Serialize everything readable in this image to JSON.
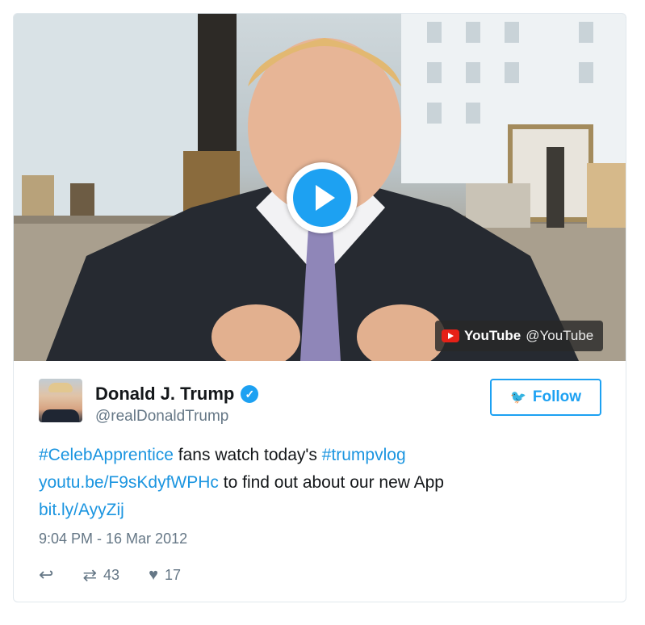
{
  "video": {
    "source_name": "YouTube",
    "source_handle": "@YouTube",
    "play_icon": "play-icon",
    "youtube_icon": "youtube-logo-icon"
  },
  "author": {
    "name": "Donald J. Trump",
    "handle": "@realDonaldTrump",
    "verified_icon": "verified-check-icon"
  },
  "follow": {
    "label": "Follow",
    "icon": "twitter-bird-icon"
  },
  "tweet": {
    "hashtag1": "#CelebApprentice",
    "text1": " fans watch today's ",
    "hashtag2": "#trumpvlog",
    "link1": "youtu.be/F9sKdyfWPHc",
    "text2": " to find out about our new App",
    "link2": "bit.ly/AyyZij"
  },
  "timestamp": "9:04 PM - 16 Mar 2012",
  "actions": {
    "reply_icon": "reply-icon",
    "retweet_icon": "retweet-icon",
    "retweet_count": "43",
    "like_icon": "heart-icon",
    "like_count": "17"
  },
  "colors": {
    "accent": "#1da1f2",
    "link": "#1b95e0",
    "secondary_text": "#657786",
    "border": "#e1e8ed",
    "youtube_red": "#e62117"
  }
}
